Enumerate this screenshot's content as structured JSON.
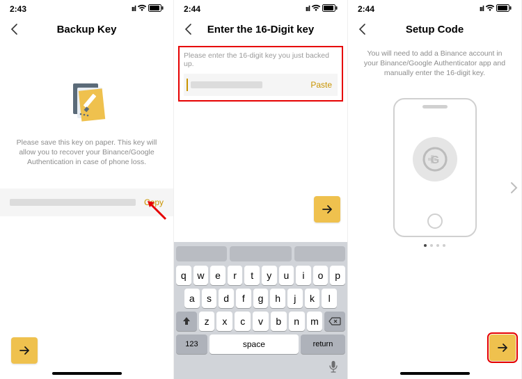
{
  "screens": [
    {
      "status_time": "2:43",
      "title": "Backup Key",
      "instruction": "Please save this key on paper. This key will allow you to recover your Binance/Google Authentication in case of phone loss.",
      "action_label": "Copy"
    },
    {
      "status_time": "2:44",
      "title": "Enter the 16-Digit key",
      "hint": "Please enter the 16-digit key you just backed up.",
      "action_label": "Paste",
      "keyboard": {
        "row1": [
          "q",
          "w",
          "e",
          "r",
          "t",
          "y",
          "u",
          "i",
          "o",
          "p"
        ],
        "row2": [
          "a",
          "s",
          "d",
          "f",
          "g",
          "h",
          "j",
          "k",
          "l"
        ],
        "row3": [
          "z",
          "x",
          "c",
          "v",
          "b",
          "n",
          "m"
        ],
        "num_label": "123",
        "space_label": "space",
        "return_label": "return"
      }
    },
    {
      "status_time": "2:44",
      "title": "Setup Code",
      "instruction": "You will need to add a Binance account in your Binance/Google Authenticator app and manually enter the 16-digit key.",
      "page_indicator": {
        "total": 4,
        "active": 0
      }
    }
  ],
  "colors": {
    "accent": "#efc14e",
    "link": "#c99400",
    "highlight": "#e60000"
  }
}
